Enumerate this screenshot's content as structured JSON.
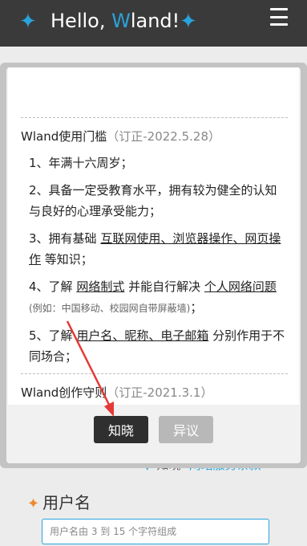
{
  "header": {
    "greeting_prefix": "Hello, ",
    "greeting_w": "W",
    "greeting_suffix": "land!"
  },
  "modal": {
    "section1_title": "Wland使用门槛",
    "section1_rev": "（订正-2022.5.28）",
    "items": {
      "i1": "1、年满十六周岁；",
      "i2": "2、具备一定受教育水平，拥有较为健全的认知与良好的心理承受能力；",
      "i3_a": "3、拥有基础 ",
      "i3_link": "互联网使用、浏览器操作、网页操作",
      "i3_b": " 等知识；",
      "i4_a": "4、了解 ",
      "i4_link1": "网络制式",
      "i4_b": " 并能自行解决 ",
      "i4_link2": "个人网络问题",
      "i4_small": "(例如：中国移动、校园网自带屏蔽墙)",
      "i4_c": "；",
      "i5_a": "5、了解 ",
      "i5_link": "用户名、昵称、电子邮箱",
      "i5_b": " 分别作用于不同场合；"
    },
    "section2_title": "Wland创作守则",
    "section2_rev": "（订正-2021.3.1）",
    "ok_label": "知晓",
    "no_label": "异议"
  },
  "page": {
    "agree_label": "知晓",
    "terms_link": "网站服务条款",
    "username_label": "用户名",
    "username_placeholder": "用户名由 3 到 15 个字符组成"
  },
  "colors": {
    "accent": "#29a3dc",
    "topbar": "#3a3a3a",
    "star_orange": "#f08a2e",
    "arrow": "#e53935"
  },
  "icons": [
    "sparkle-icon",
    "menu-icon",
    "triangle-icon",
    "star-icon"
  ]
}
